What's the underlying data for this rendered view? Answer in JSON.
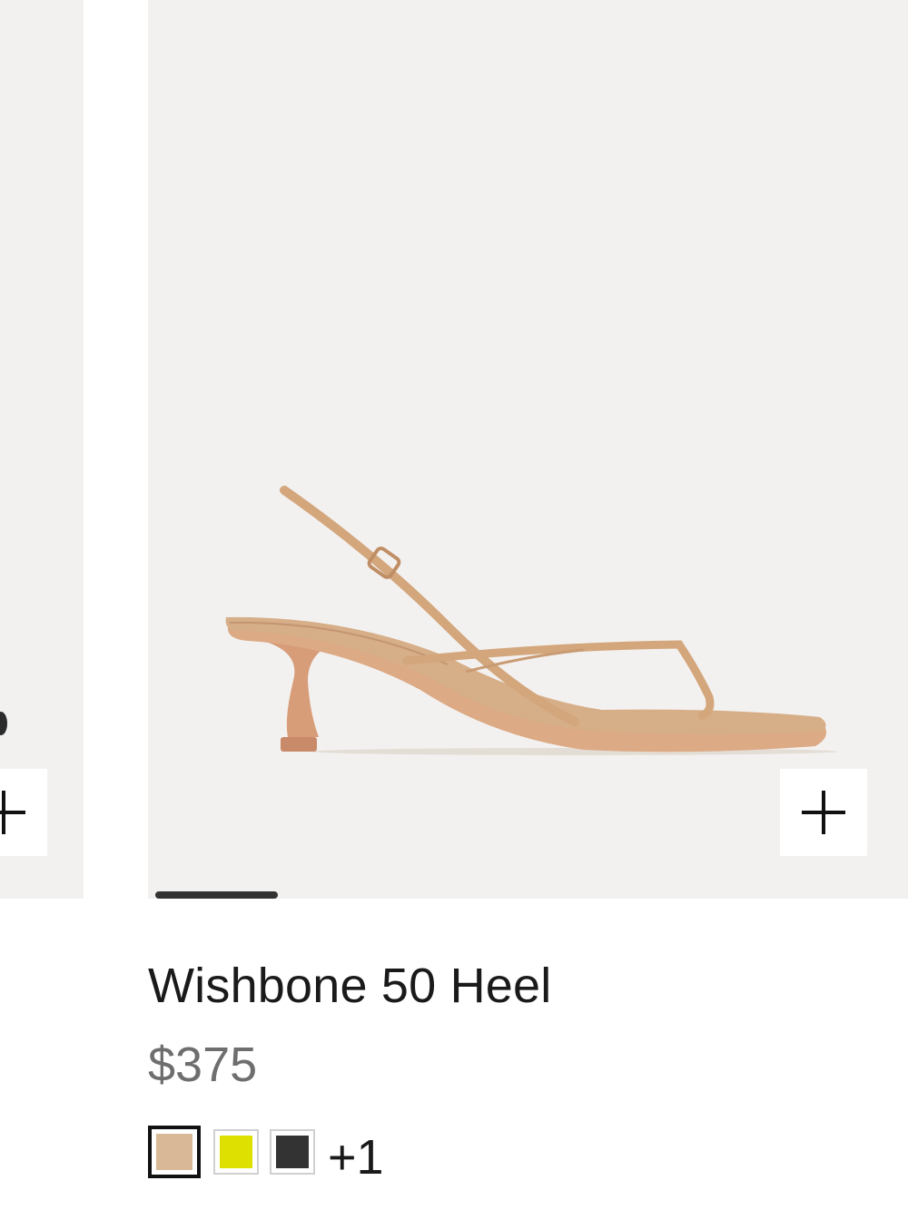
{
  "product": {
    "name": "Wishbone 50 Heel",
    "price": "$375"
  },
  "swatches": {
    "items": [
      {
        "color": "#d8b896",
        "selected": true
      },
      {
        "color": "#dde000",
        "selected": false
      },
      {
        "color": "#333333",
        "selected": false
      }
    ],
    "more_label": "+1"
  },
  "carousel": {
    "progress": 0.17
  },
  "colors": {
    "image_background": "#f3f1f0",
    "sandal_leather": "#d3a67c",
    "heel": "#d79c78",
    "price_text": "#6e6e6e"
  },
  "icons": {
    "add_to_bag": "plus-icon"
  }
}
